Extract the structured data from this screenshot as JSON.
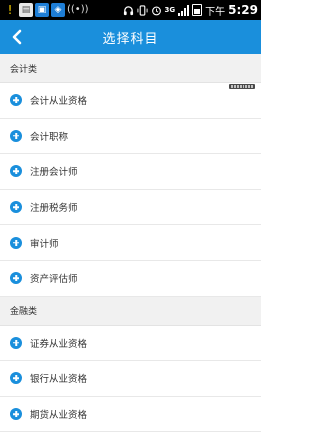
{
  "status_bar": {
    "apps": [
      {
        "icon": "warning-icon",
        "glyph": "!"
      },
      {
        "icon": "news-icon",
        "glyph": "▤"
      },
      {
        "icon": "app-icon",
        "glyph": "▣"
      },
      {
        "icon": "app-icon",
        "glyph": "◈"
      },
      {
        "icon": "wifi-hotspot-icon",
        "glyph": "((•))"
      }
    ],
    "network": "3G",
    "time_prefix": "下午",
    "time": "5:29"
  },
  "nav": {
    "title": "选择科目",
    "back_icon": "chevron-left-icon"
  },
  "colors": {
    "accent": "#1a8fdc",
    "section_bg": "#f1f1f1"
  },
  "sections": [
    {
      "header": "会计类",
      "items": [
        {
          "label": "会计从业资格"
        },
        {
          "label": "会计职称"
        },
        {
          "label": "注册会计师"
        },
        {
          "label": "注册税务师"
        },
        {
          "label": "审计师"
        },
        {
          "label": "资产评估师"
        }
      ]
    },
    {
      "header": "金融类",
      "items": [
        {
          "label": "证券从业资格"
        },
        {
          "label": "银行从业资格"
        },
        {
          "label": "期货从业资格"
        }
      ]
    }
  ]
}
